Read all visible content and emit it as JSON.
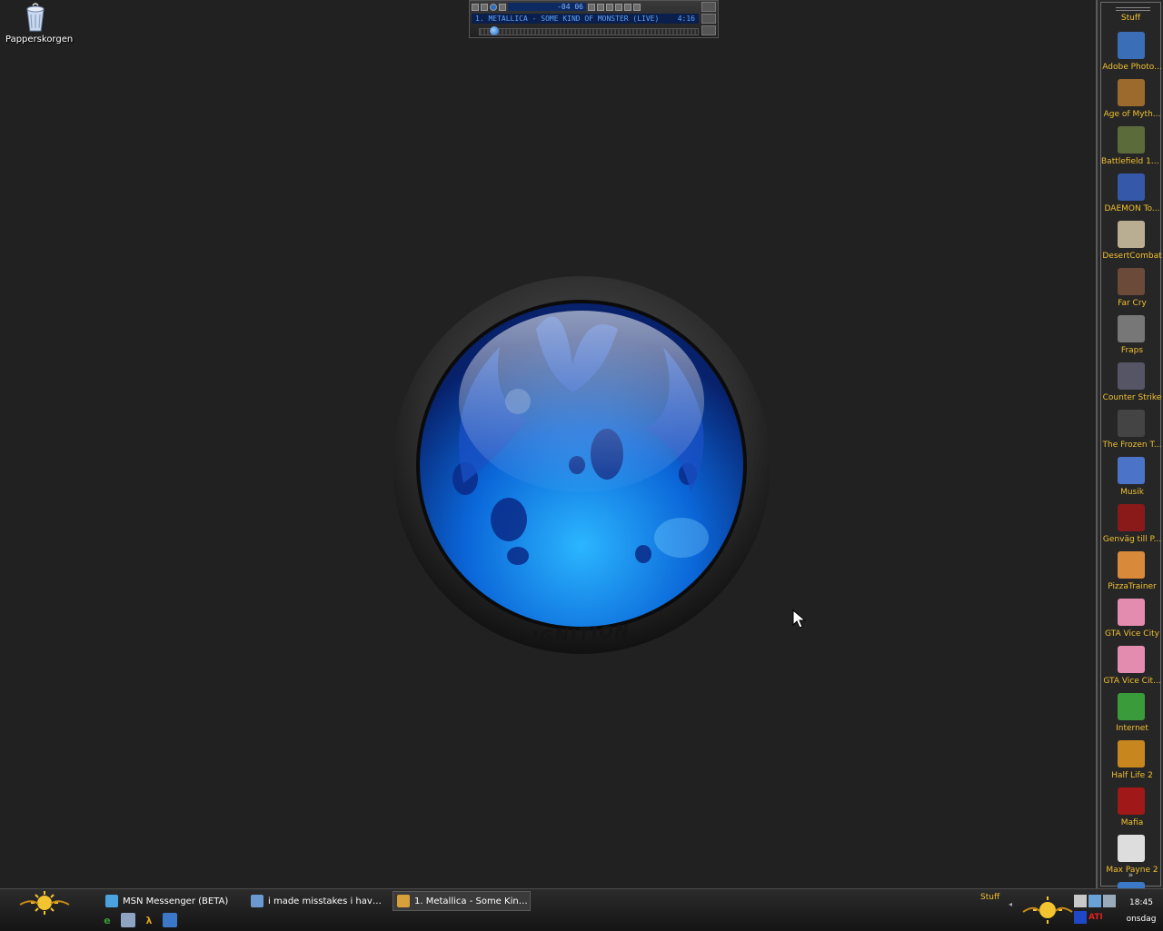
{
  "desktop": {
    "recycle_bin_label": "Papperskorgen"
  },
  "winamp": {
    "time_display": "-04 06",
    "track_title": "1. METALLICA - SOME KIND OF MONSTER (LIVE)",
    "track_length": "4:16"
  },
  "logo": {
    "text": "IGNITION"
  },
  "dock": {
    "title": "Stuff",
    "more": "»",
    "items": [
      {
        "label": "Adobe Photo...",
        "icon": "photoshop-icon",
        "color": "#3a6fb8"
      },
      {
        "label": "Age of Myth...",
        "icon": "age-of-mythology-icon",
        "color": "#9b6a2c"
      },
      {
        "label": "Battlefield 19...",
        "icon": "battlefield-icon",
        "color": "#5c6b3a"
      },
      {
        "label": "DAEMON To...",
        "icon": "daemon-tools-icon",
        "color": "#3558a8"
      },
      {
        "label": "DesertCombat",
        "icon": "desert-combat-icon",
        "color": "#b9ad92"
      },
      {
        "label": "Far Cry",
        "icon": "far-cry-icon",
        "color": "#6b4a3a"
      },
      {
        "label": "Fraps",
        "icon": "fraps-icon",
        "color": "#777"
      },
      {
        "label": "Counter Strike",
        "icon": "counter-strike-icon",
        "color": "#556"
      },
      {
        "label": "The Frozen T...",
        "icon": "frozen-throne-icon",
        "color": "#444"
      },
      {
        "label": "Musik",
        "icon": "folder-icon",
        "color": "#4b74c9"
      },
      {
        "label": "Genväg till P...",
        "icon": "postal-icon",
        "color": "#8a1a1a"
      },
      {
        "label": "PizzaTrainer",
        "icon": "pizza-icon",
        "color": "#d9893a"
      },
      {
        "label": "GTA Vice City",
        "icon": "gta-vice-city-icon",
        "color": "#e48bb0"
      },
      {
        "label": "GTA Vice Cit...",
        "icon": "gta-vice-city-2-icon",
        "color": "#e48bb0"
      },
      {
        "label": "Internet",
        "icon": "internet-explorer-icon",
        "color": "#3a9b3a"
      },
      {
        "label": "Half Life 2",
        "icon": "half-life-2-icon",
        "color": "#c8861e"
      },
      {
        "label": "Mafia",
        "icon": "mafia-icon",
        "color": "#a01818"
      },
      {
        "label": "Max Payne 2",
        "icon": "max-payne-2-icon",
        "color": "#ddd"
      },
      {
        "label": "",
        "icon": "control-panel-icon",
        "color": "#3c78c8"
      }
    ]
  },
  "taskbar": {
    "buttons": [
      {
        "label": "MSN Messenger (BETA)",
        "icon": "msn-icon",
        "color": "#4aa3df"
      },
      {
        "label": "i made misstakes i have d...",
        "icon": "chat-icon",
        "color": "#6a9ad0"
      },
      {
        "label": "1. Metallica - Some Kind o...",
        "icon": "winamp-icon",
        "color": "#d8a03a"
      }
    ],
    "stuff_label": "Stuff",
    "clock_time": "18:45",
    "clock_day": "onsdag",
    "tray_ati": "ATI"
  }
}
